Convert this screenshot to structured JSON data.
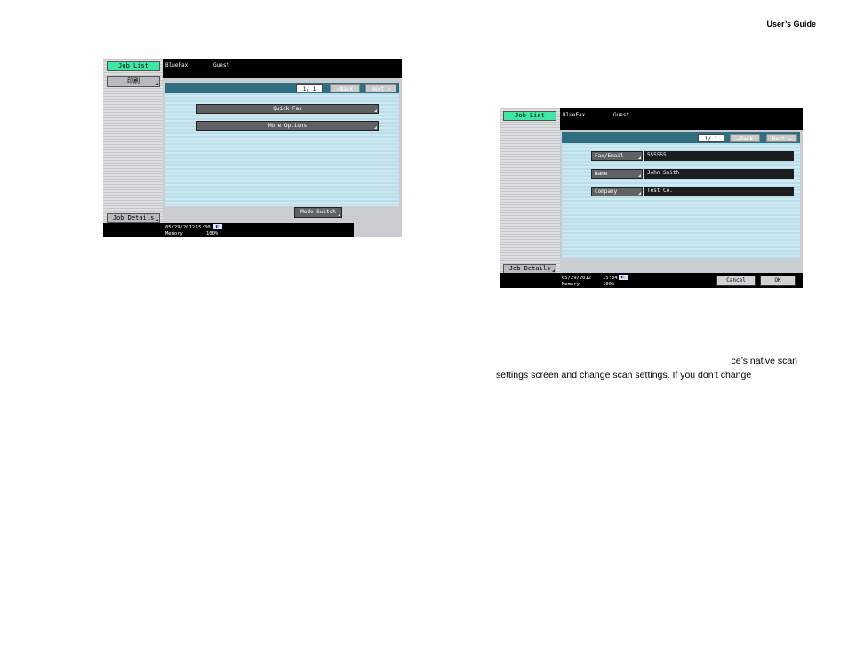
{
  "header": {
    "title": "User’s Guide"
  },
  "screen1": {
    "job_list": "Job List",
    "sidebar_btn2": "印刷",
    "job_details": "Job Details",
    "top_app": "BlueFax",
    "top_user": "Guest",
    "page": "1/ 1",
    "back": "←Back",
    "next": "Next →",
    "menu": [
      "Quick Fax",
      "More Options"
    ],
    "mode_switch": "Mode Switch",
    "date": "05/29/2012",
    "time": "15:30",
    "memory_label": "Memory",
    "memory_value": "100%"
  },
  "screen2": {
    "job_list": "Job List",
    "job_details": "Job Details",
    "top_app": "BlueFax",
    "top_user": "Guest",
    "page": "1/ 1",
    "back": "←Back",
    "next": "Next →",
    "fields": [
      {
        "label": "Fax/Email",
        "value": "555555"
      },
      {
        "label": "Name",
        "value": "John Smith"
      },
      {
        "label": "Company",
        "value": "Test Co."
      }
    ],
    "cancel": "Cancel",
    "ok": "OK",
    "date": "05/29/2012",
    "time": "15:34",
    "memory_label": "Memory",
    "memory_value": "100%"
  },
  "body": {
    "line1": "ce’s native scan",
    "line2": "settings screen and change scan settings. If you don’t change"
  }
}
